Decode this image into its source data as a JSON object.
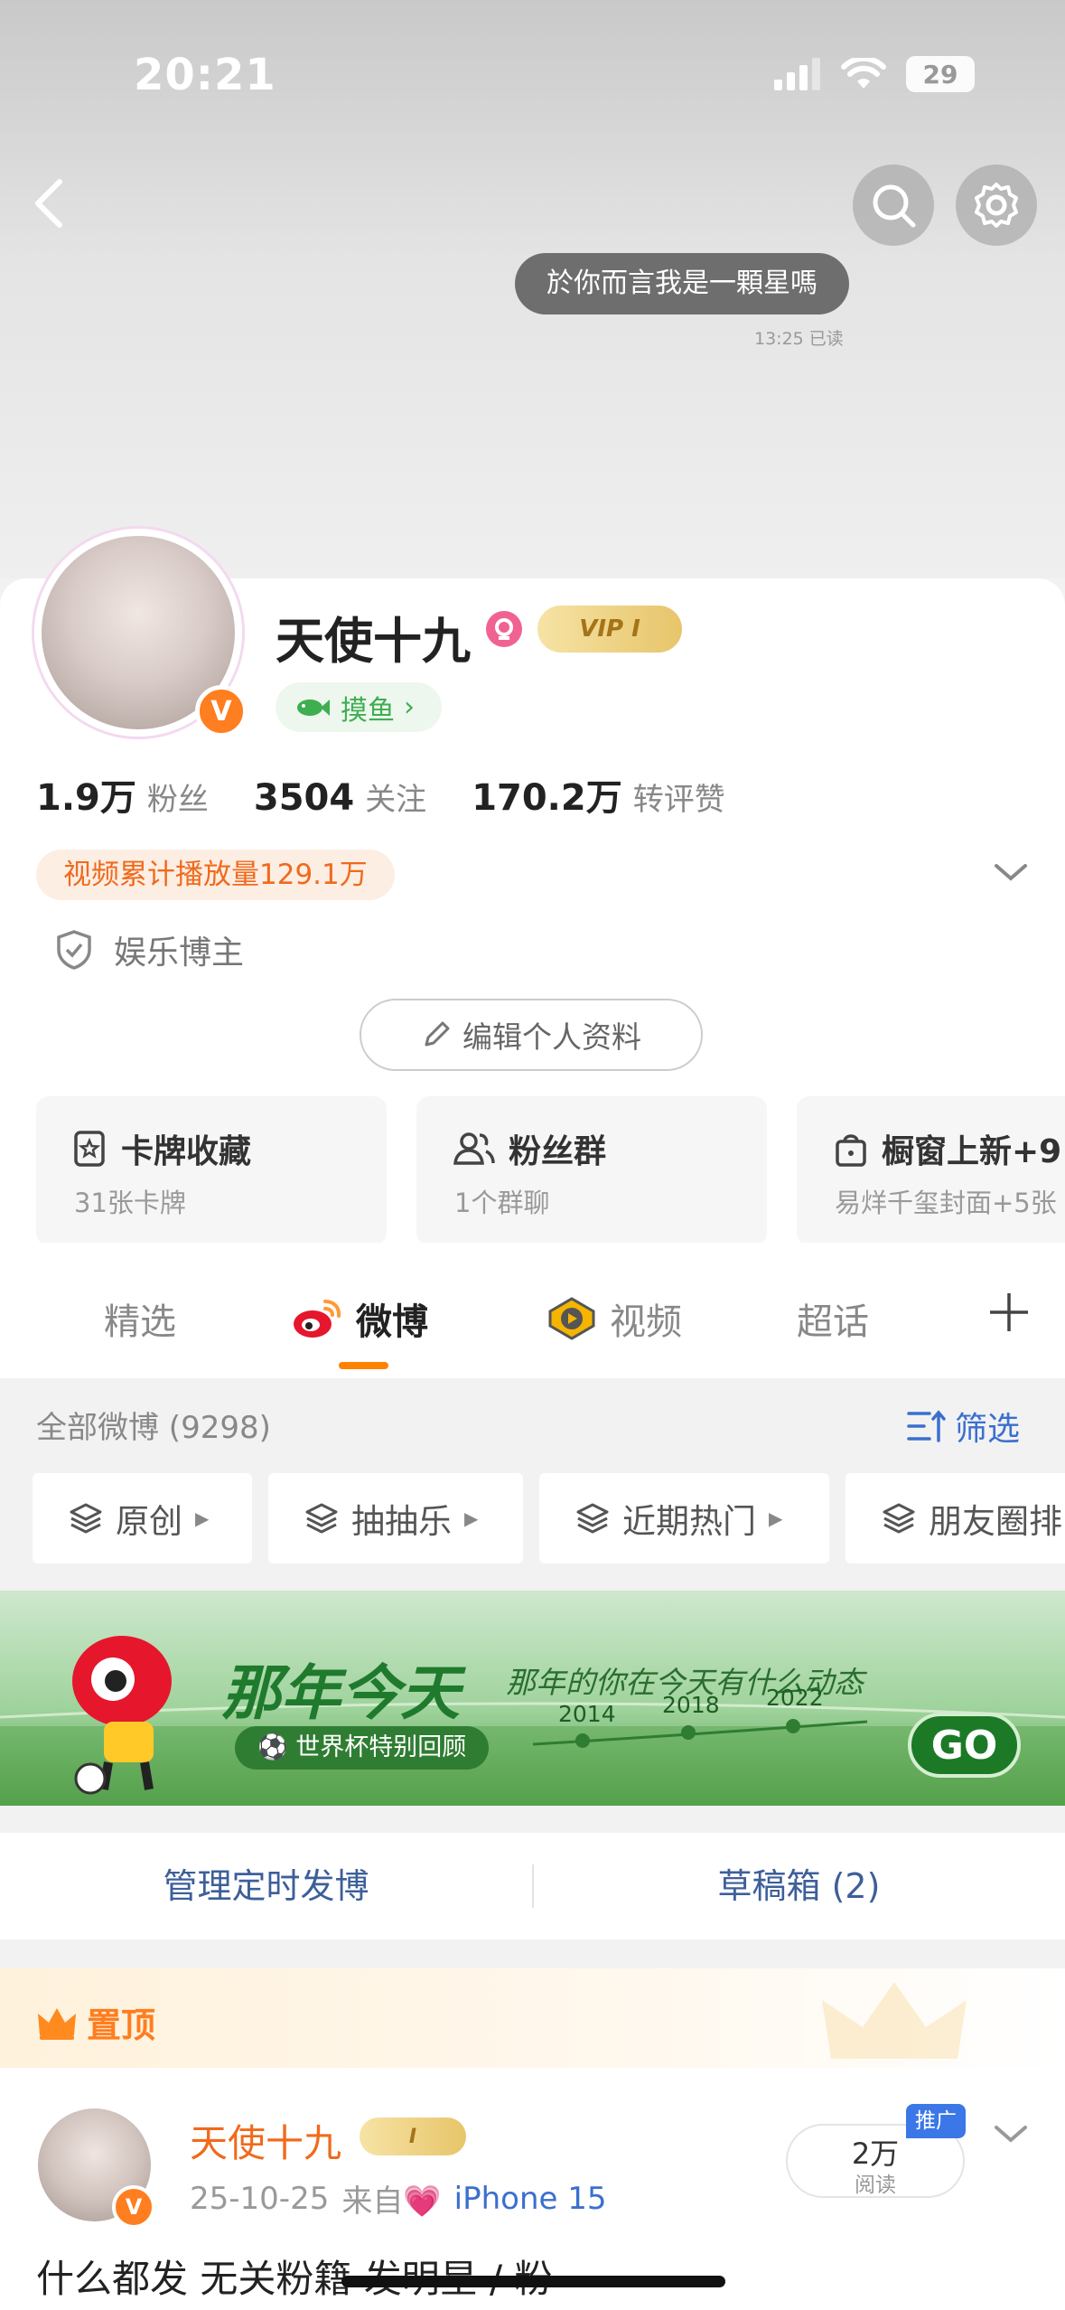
{
  "status_bar": {
    "time": "20:21",
    "battery": "29"
  },
  "chat_bubble": {
    "text": "於你而言我是一顆星嗎",
    "meta": "13:25 已读"
  },
  "profile": {
    "username": "天使十九",
    "vip_label": "VIP I",
    "badge_v": "V",
    "tag": "摸鱼",
    "stats": [
      {
        "num": "1.9万",
        "label": "粉丝"
      },
      {
        "num": "3504",
        "label": "关注"
      },
      {
        "num": "170.2万",
        "label": "转评赞"
      }
    ],
    "play_count": "视频累计播放量129.1万",
    "role": "娱乐博主",
    "edit_button": "编辑个人资料"
  },
  "cards": [
    {
      "title": "卡牌收藏",
      "sub": "31张卡牌"
    },
    {
      "title": "粉丝群",
      "sub": "1个群聊"
    },
    {
      "title": "橱窗上新+9",
      "sub": "易烊千玺封面+5张"
    }
  ],
  "tabs": [
    {
      "label": "精选"
    },
    {
      "label": "微博"
    },
    {
      "label": "视频"
    },
    {
      "label": "超话"
    }
  ],
  "filter": {
    "heading": "全部微博 (9298)",
    "button": "筛选",
    "chips": [
      "原创",
      "抽抽乐",
      "近期热门",
      "朋友圈排"
    ]
  },
  "banner": {
    "title": "那年今天",
    "tagline": "那年的你在今天有什么动态",
    "pill": "世界杯特别回顾",
    "years": [
      "2014",
      "2018",
      "2022"
    ],
    "go": "GO"
  },
  "manage": {
    "scheduled": "管理定时发博",
    "drafts": "草稿箱 (2)"
  },
  "pinned": {
    "label": "置顶",
    "author": "天使十九",
    "vip_label": "I",
    "date": "25-10-25",
    "from_label": "来自",
    "device": "iPhone 15",
    "reads_num": "2万",
    "reads_label": "阅读",
    "promo": "推广",
    "text": "什么都发 无关粉籍 发明星 / 粉"
  },
  "colors": {
    "accent": "#ff8200",
    "link": "#3b6fcf",
    "orange_text": "#f06a1c"
  }
}
